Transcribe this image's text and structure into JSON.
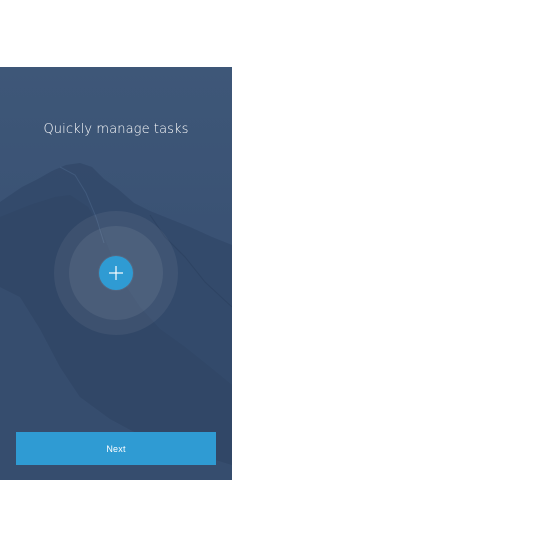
{
  "onboarding": {
    "title": "Quickly manage tasks",
    "add_icon": "plus-icon",
    "next_label": "Next"
  },
  "colors": {
    "background": "#3a5274",
    "accent": "#2f9bd3",
    "text": "#ffffff"
  }
}
